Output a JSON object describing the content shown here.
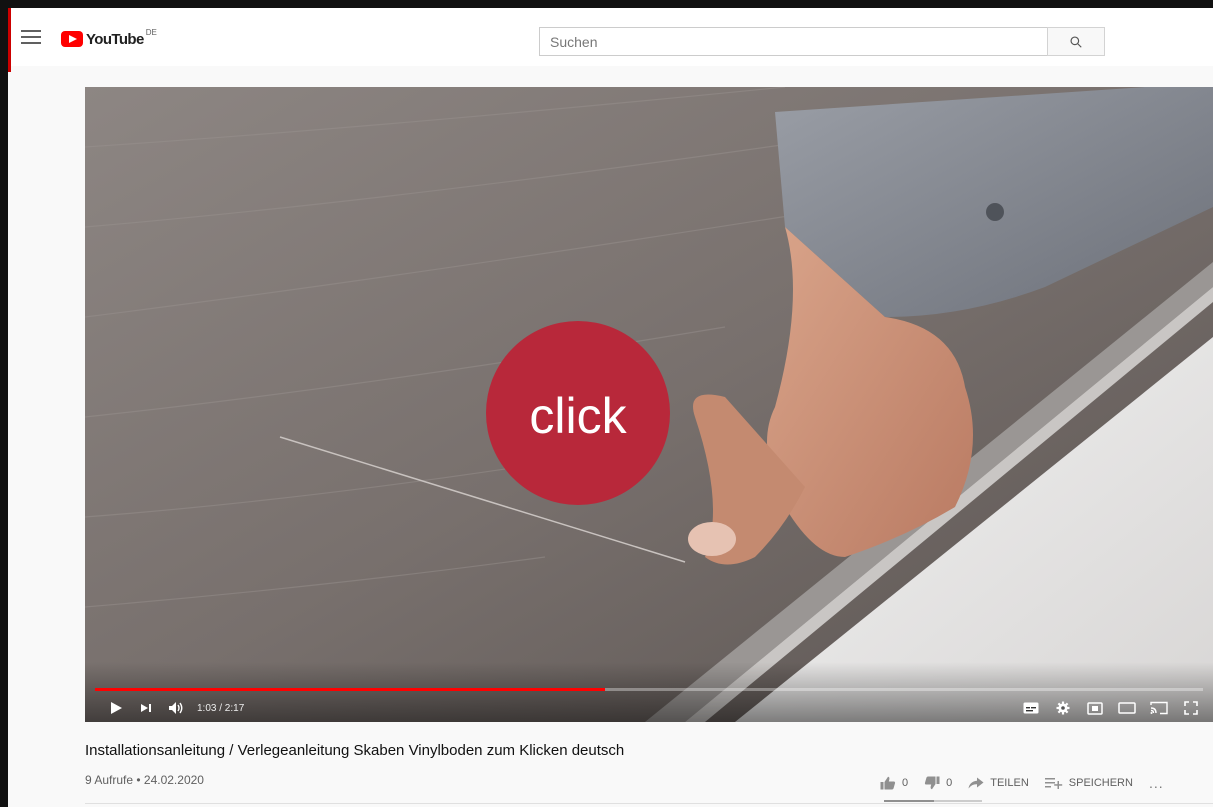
{
  "header": {
    "logo_text": "YouTube",
    "logo_region": "DE",
    "search_placeholder": "Suchen",
    "icons": [
      "menu-icon",
      "youtube-logo-icon",
      "search-icon"
    ]
  },
  "player": {
    "overlay_text": "click",
    "current_time": "1:03",
    "duration": "2:17",
    "time_display": "1:03 / 2:17",
    "progress_fraction": 0.46,
    "progress_color": "#ff0000",
    "icons": [
      "play-icon",
      "next-icon",
      "volume-icon",
      "subtitles-icon",
      "settings-icon",
      "miniplayer-icon",
      "theater-icon",
      "cast-icon",
      "fullscreen-icon"
    ]
  },
  "video": {
    "title": "Installationsanleitung / Verlegeanleitung Skaben Vinylboden zum Klicken deutsch",
    "meta": "9 Aufrufe • 24.02.2020",
    "likes": "0",
    "dislikes": "0",
    "share_label": "TEILEN",
    "save_label": "SPEICHERN",
    "more_label": "...",
    "icons": [
      "like-icon",
      "dislike-icon",
      "share-icon",
      "save-playlist-icon",
      "more-icon"
    ]
  },
  "colors": {
    "brand_red": "#ff0000",
    "click_badge": "#b8283a",
    "background": "#f9f9f9"
  }
}
